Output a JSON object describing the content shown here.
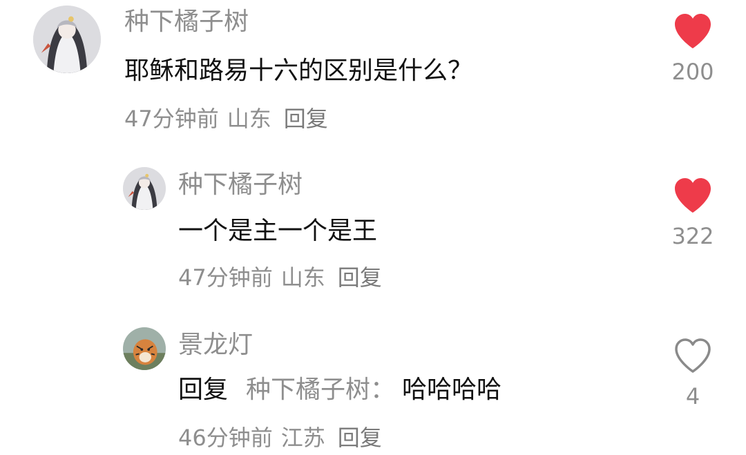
{
  "comments": [
    {
      "username": "种下橘子树",
      "text": "耶稣和路易十六的区别是什么？",
      "time": "47分钟前",
      "region": "山东",
      "reply_label": "回复",
      "likes": "200",
      "liked": true,
      "avatar_icon": "anime-girl-avatar"
    },
    {
      "username": "种下橘子树",
      "text": "一个是主一个是王",
      "time": "47分钟前",
      "region": "山东",
      "reply_label": "回复",
      "likes": "322",
      "liked": true,
      "avatar_icon": "anime-girl-avatar"
    },
    {
      "username": "景龙灯",
      "reply_prefix": "回复",
      "reply_target": "种下橘子树",
      "reply_colon": "：",
      "reply_body": "哈哈哈哈",
      "time": "46分钟前",
      "region": "江苏",
      "reply_label": "回复",
      "likes": "4",
      "liked": false,
      "avatar_icon": "tiger-avatar"
    }
  ],
  "colors": {
    "heart_liked": "#ee3b4a",
    "heart_outline": "#8a8a8a",
    "muted_text": "#8e8e8e"
  }
}
